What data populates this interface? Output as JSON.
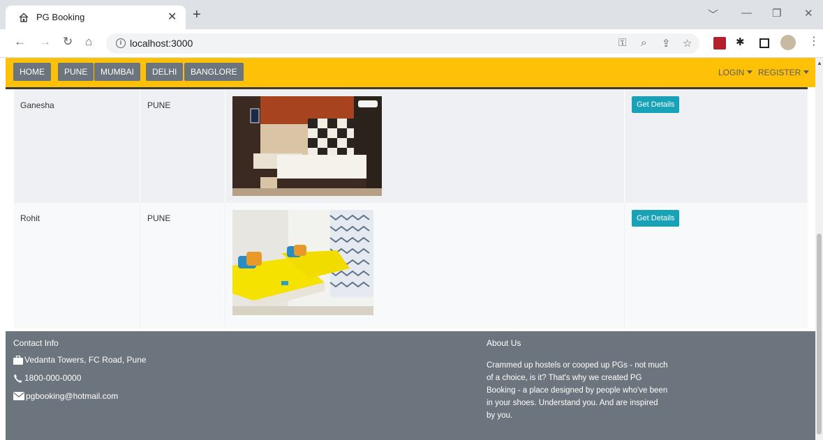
{
  "browser": {
    "tab_title": "PG Booking",
    "url": "localhost:3000"
  },
  "nav": {
    "items": [
      "HOME",
      "PUNE",
      "MUMBAI",
      "DELHI",
      "BANGLORE"
    ],
    "login_label": "LOGIN",
    "register_label": "REGISTER"
  },
  "listings": [
    {
      "name": "Ganesha",
      "city": "PUNE",
      "button_label": "Get Details"
    },
    {
      "name": "Rohit",
      "city": "PUNE",
      "button_label": "Get Details"
    }
  ],
  "footer": {
    "contact_heading": "Contact Info",
    "address": "Vedanta Towers, FC Road, Pune",
    "phone": "1800-000-0000",
    "email": "pgbooking@hotmail.com",
    "about_heading": "About Us",
    "about_text": "Crammed up hostels or cooped up PGs - not much of a choice, is it? That's why we created PG Booking - a place designed by people who've been in your shoes. Understand you. And are inspired by you."
  },
  "colors": {
    "navbar": "#ffc107",
    "nav_button": "#6c757d",
    "details_button": "#17a2b8",
    "footer": "#6c757d"
  }
}
